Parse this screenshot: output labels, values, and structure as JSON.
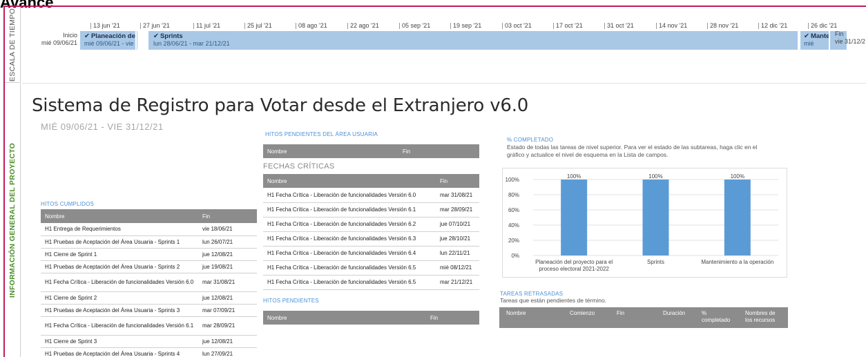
{
  "page": {
    "title": "Avance"
  },
  "side": {
    "timeline_label": "ESCALA DE TIEMPO",
    "info_label": "INFORMACIÓN GENERAL DEL PROYECTO"
  },
  "timeline": {
    "ticks": [
      "13 jun '21",
      "27 jun '21",
      "11 jul '21",
      "25 jul '21",
      "08 ago '21",
      "22 ago '21",
      "05 sep '21",
      "19 sep '21",
      "03 oct '21",
      "17 oct '21",
      "31 oct '21",
      "14 nov '21",
      "28 nov '21",
      "12 dic '21",
      "26 dic '21"
    ],
    "start": {
      "label": "Inicio",
      "date": "mié 09/06/21"
    },
    "end": {
      "label": "Fin",
      "date": "vie 31/12/2"
    },
    "bars": [
      {
        "name": "Planeación del",
        "dates": "mié 09/06/21 - vie"
      },
      {
        "name": "Sprints",
        "dates": "lun 28/06/21 - mar 21/12/21"
      },
      {
        "name": "Mante",
        "dates": "mié"
      }
    ]
  },
  "project": {
    "title": "Sistema de Registro para Votar desde el Extranjero v6.0",
    "dates": "MIÉ 09/06/21 - VIE 31/12/21"
  },
  "hitos_cumplidos": {
    "title": "HITOS CUMPLIDOS",
    "headers": [
      "Nombre",
      "Fin"
    ],
    "rows": [
      {
        "name": "H1 Entrega de Requerimientos",
        "fin": "vie 18/06/21"
      },
      {
        "name": "H1 Pruebas de Aceptación del Área Usuaria - Sprints 1",
        "fin": "lun 26/07/21"
      },
      {
        "name": "H1 Cierre de Sprint 1",
        "fin": "jue 12/08/21"
      },
      {
        "name": "H1 Pruebas de Aceptación del Área Usuaria - Sprints 2",
        "fin": "jue 19/08/21"
      },
      {
        "name": "H1 Fecha Crítica - Liberación de funcionalidades Versión 6.0",
        "fin": "mar 31/08/21"
      },
      {
        "name": "H1 Cierre de Sprint 2",
        "fin": "jue 12/08/21"
      },
      {
        "name": "H1 Pruebas de Aceptación del Área Usuaria - Sprints 3",
        "fin": "mar 07/09/21"
      },
      {
        "name": "H1 Fecha Crítica - Liberación de funcionalidades Versión 6.1",
        "fin": "mar 28/09/21"
      },
      {
        "name": "H1 Cierre de Sprint 3",
        "fin": "jue 12/08/21"
      },
      {
        "name": "H1 Pruebas de Aceptación del Área Usuaria - Sprints 4",
        "fin": "lun 27/09/21"
      }
    ]
  },
  "hitos_usuaria": {
    "title": "HITOS PENDIENTES DEL ÁREA USUARIA",
    "headers": [
      "Nombre",
      "Fin"
    ]
  },
  "fechas_criticas": {
    "title": "FECHAS CRÍTICAS",
    "headers": [
      "Nombre",
      "Fin"
    ],
    "rows": [
      {
        "name": "H1 Fecha Crítica - Liberación de funcionalidades Versión 6.0",
        "fin": "mar 31/08/21"
      },
      {
        "name": "H1 Fecha Crítica - Liberación de funcionalidades Versión 6.1",
        "fin": "mar 28/09/21"
      },
      {
        "name": "H1 Fecha Crítica - Liberación de funcionalidades Versión 6.2",
        "fin": "jue 07/10/21"
      },
      {
        "name": "H1 Fecha Crítica - Liberación de funcionalidades Versión 6.3",
        "fin": "jue 28/10/21"
      },
      {
        "name": "H1 Fecha Crítica - Liberación de funcionalidades Versión 6.4",
        "fin": "lun 22/11/21"
      },
      {
        "name": "H1 Fecha Crítica - Liberación de funcionalidades Versión 6.5",
        "fin": "mié 08/12/21"
      },
      {
        "name": "H1 Fecha Crítica - Liberación de funcionalidades Versión 6.5",
        "fin": "mar 21/12/21"
      }
    ]
  },
  "hitos_pendientes": {
    "title": "HITOS PENDIENTES",
    "headers": [
      "Nombre",
      "Fin"
    ]
  },
  "completado": {
    "title": "% COMPLETADO",
    "subtitle": "Estado de todas las tareas de nivel superior. Para ver el estado de las subtareas, haga clic en el gráfico y actualice el nivel de esquema en la Lista de campos."
  },
  "chart_data": {
    "type": "bar",
    "categories": [
      "Planeación del proyecto para el proceso electoral 2021-2022",
      "Sprints",
      "Mantenimiento a la operación"
    ],
    "category_lines": [
      [
        "Planeación del proyecto para el",
        "proceso electoral 2021-2022"
      ],
      [
        "Sprints"
      ],
      [
        "Mantenimiento a la operación"
      ]
    ],
    "values": [
      100,
      100,
      100
    ],
    "data_labels": [
      "100%",
      "100%",
      "100%"
    ],
    "ylim": [
      0,
      100
    ],
    "yticks": [
      "0%",
      "20%",
      "40%",
      "60%",
      "80%",
      "100%"
    ],
    "bar_color": "#5b9bd5",
    "grid": true
  },
  "retrasadas": {
    "title": "TAREAS RETRASADAS",
    "subtitle": "Tareas que están pendientes de término.",
    "headers": [
      "Nombre",
      "Comienzo",
      "Fin",
      "Duración",
      "% completado",
      "Nombres de los recursos"
    ]
  },
  "colors": {
    "accent": "#c2185b",
    "info_green": "#4b8f2c",
    "section_blue": "#4a8fd6",
    "timeline_bar": "#a9c8e6",
    "header_grey": "#8c8c8c"
  }
}
